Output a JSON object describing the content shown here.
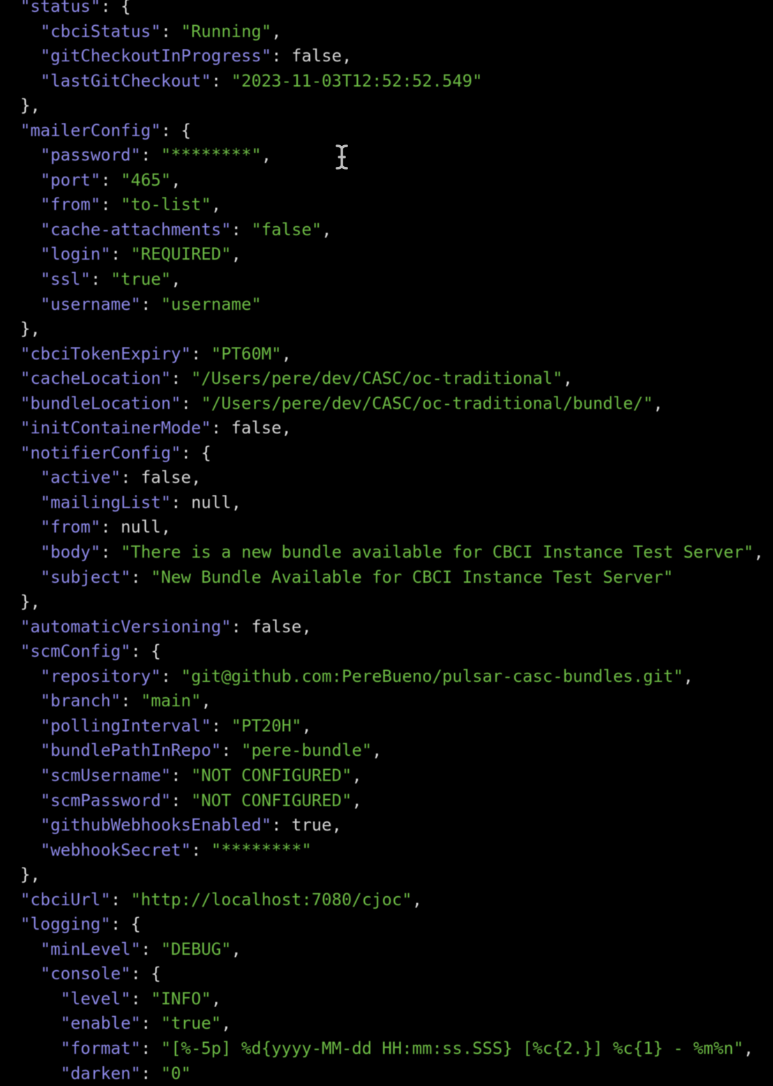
{
  "terminal": {
    "indent_unit": "  ",
    "colors": {
      "background": "#000000",
      "key": "#8c88e6",
      "string": "#6cba44",
      "literal": "#d4d4d4",
      "punctuation": "#e0e0e0"
    },
    "lines": [
      {
        "indent": 0,
        "key": "status",
        "open": "{"
      },
      {
        "indent": 1,
        "key": "cbciStatus",
        "str": "Running",
        "comma": true
      },
      {
        "indent": 1,
        "key": "gitCheckoutInProgress",
        "lit": "false",
        "comma": true
      },
      {
        "indent": 1,
        "key": "lastGitCheckout",
        "str": "2023-11-03T12:52:52.549"
      },
      {
        "indent": 0,
        "close": "}",
        "comma": true
      },
      {
        "indent": 0,
        "key": "mailerConfig",
        "open": "{"
      },
      {
        "indent": 1,
        "key": "password",
        "str": "********",
        "comma": true
      },
      {
        "indent": 1,
        "key": "port",
        "str": "465",
        "comma": true
      },
      {
        "indent": 1,
        "key": "from",
        "str": "to-list",
        "comma": true
      },
      {
        "indent": 1,
        "key": "cache-attachments",
        "str": "false",
        "comma": true
      },
      {
        "indent": 1,
        "key": "login",
        "str": "REQUIRED",
        "comma": true
      },
      {
        "indent": 1,
        "key": "ssl",
        "str": "true",
        "comma": true
      },
      {
        "indent": 1,
        "key": "username",
        "str": "username"
      },
      {
        "indent": 0,
        "close": "}",
        "comma": true
      },
      {
        "indent": 0,
        "key": "cbciTokenExpiry",
        "str": "PT60M",
        "comma": true
      },
      {
        "indent": 0,
        "key": "cacheLocation",
        "str": "/Users/pere/dev/CASC/oc-traditional",
        "comma": true
      },
      {
        "indent": 0,
        "key": "bundleLocation",
        "str": "/Users/pere/dev/CASC/oc-traditional/bundle/",
        "comma": true
      },
      {
        "indent": 0,
        "key": "initContainerMode",
        "lit": "false",
        "comma": true
      },
      {
        "indent": 0,
        "key": "notifierConfig",
        "open": "{"
      },
      {
        "indent": 1,
        "key": "active",
        "lit": "false",
        "comma": true
      },
      {
        "indent": 1,
        "key": "mailingList",
        "lit": "null",
        "comma": true
      },
      {
        "indent": 1,
        "key": "from",
        "lit": "null",
        "comma": true
      },
      {
        "indent": 1,
        "key": "body",
        "str": "There is a new bundle available for CBCI Instance Test Server",
        "comma": true
      },
      {
        "indent": 1,
        "key": "subject",
        "str": "New Bundle Available for CBCI Instance Test Server"
      },
      {
        "indent": 0,
        "close": "}",
        "comma": true
      },
      {
        "indent": 0,
        "key": "automaticVersioning",
        "lit": "false",
        "comma": true
      },
      {
        "indent": 0,
        "key": "scmConfig",
        "open": "{"
      },
      {
        "indent": 1,
        "key": "repository",
        "str": "git@github.com:PereBueno/pulsar-casc-bundles.git",
        "comma": true
      },
      {
        "indent": 1,
        "key": "branch",
        "str": "main",
        "comma": true
      },
      {
        "indent": 1,
        "key": "pollingInterval",
        "str": "PT20H",
        "comma": true
      },
      {
        "indent": 1,
        "key": "bundlePathInRepo",
        "str": "pere-bundle",
        "comma": true
      },
      {
        "indent": 1,
        "key": "scmUsername",
        "str": "NOT CONFIGURED",
        "comma": true
      },
      {
        "indent": 1,
        "key": "scmPassword",
        "str": "NOT CONFIGURED",
        "comma": true
      },
      {
        "indent": 1,
        "key": "githubWebhooksEnabled",
        "lit": "true",
        "comma": true
      },
      {
        "indent": 1,
        "key": "webhookSecret",
        "str": "********"
      },
      {
        "indent": 0,
        "close": "}",
        "comma": true
      },
      {
        "indent": 0,
        "key": "cbciUrl",
        "str": "http://localhost:7080/cjoc",
        "comma": true
      },
      {
        "indent": 0,
        "key": "logging",
        "open": "{"
      },
      {
        "indent": 1,
        "key": "minLevel",
        "str": "DEBUG",
        "comma": true
      },
      {
        "indent": 1,
        "key": "console",
        "open": "{"
      },
      {
        "indent": 2,
        "key": "level",
        "str": "INFO",
        "comma": true
      },
      {
        "indent": 2,
        "key": "enable",
        "str": "true",
        "comma": true
      },
      {
        "indent": 2,
        "key": "format",
        "str": "[%-5p] %d{yyyy-MM-dd HH:mm:ss.SSS} [%c{2.}] %c{1} - %m%n",
        "comma": true
      },
      {
        "indent": 2,
        "key": "darken",
        "str": "0"
      }
    ]
  },
  "cursor": {
    "icon": "text-cursor-ibeam-icon"
  }
}
